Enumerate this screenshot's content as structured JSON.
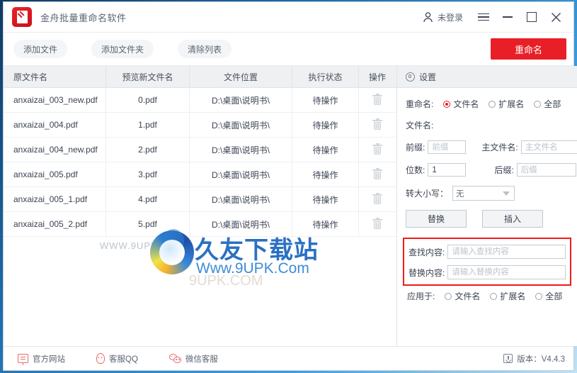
{
  "window": {
    "title": "金舟批量重命名软件",
    "app_icon": "pen-document-icon",
    "user_label": "未登录",
    "user_icon": "person-icon",
    "menu_icon": "hamburger-icon",
    "minimize_icon": "minimize-icon",
    "maximize_icon": "maximize-icon",
    "close_icon": "close-icon"
  },
  "toolbar": {
    "add_file": "添加文件",
    "add_folder": "添加文件夹",
    "clear_list": "清除列表",
    "rename": "重命名",
    "rename_color": "#e81f26"
  },
  "table": {
    "headers": [
      "原文件名",
      "预览新文件名",
      "文件位置",
      "执行状态",
      "操作"
    ],
    "delete_icon": "trash-icon",
    "rows": [
      {
        "original": "anxaizai_003_new.pdf",
        "preview": "0.pdf",
        "location": "D:\\桌面\\说明书\\",
        "status": "待操作"
      },
      {
        "original": "anxaizai_004.pdf",
        "preview": "1.pdf",
        "location": "D:\\桌面\\说明书\\",
        "status": "待操作"
      },
      {
        "original": "anxaizai_004_new.pdf",
        "preview": "2.pdf",
        "location": "D:\\桌面\\说明书\\",
        "status": "待操作"
      },
      {
        "original": "anxaizai_005.pdf",
        "preview": "3.pdf",
        "location": "D:\\桌面\\说明书\\",
        "status": "待操作"
      },
      {
        "original": "anxaizai_005_1.pdf",
        "preview": "4.pdf",
        "location": "D:\\桌面\\说明书\\",
        "status": "待操作"
      },
      {
        "original": "anxaizai_005_2.pdf",
        "preview": "5.pdf",
        "location": "D:\\桌面\\说明书\\",
        "status": "待操作"
      }
    ]
  },
  "watermark": {
    "brand": "久友下载站",
    "url": "Www.9UPK.Com",
    "small": "WWW.9UPK.COM",
    "ghost": "9UPK.COM"
  },
  "settings": {
    "panel_title": "设置",
    "panel_icon": "gear-icon",
    "rename_label": "重命名:",
    "rename_options": [
      {
        "label": "文件名",
        "selected": true
      },
      {
        "label": "扩展名",
        "selected": false
      },
      {
        "label": "全部",
        "selected": false
      }
    ],
    "filename_label": "文件名:",
    "prefix_label": "前缀:",
    "prefix_placeholder": "前缀",
    "prefix_value": "",
    "mainname_label": "主文件名:",
    "mainname_placeholder": "主文件名",
    "mainname_value": "",
    "digits_label": "位数:",
    "digits_value": "1",
    "suffix_label": "后缀:",
    "suffix_placeholder": "后缀",
    "suffix_value": "",
    "case_label": "转大小写：",
    "case_value": "无",
    "case_caret": "chevron-down-icon",
    "replace_button": "替换",
    "insert_button": "插入",
    "highlight_color": "#f01a1a",
    "find_label": "查找内容:",
    "find_placeholder": "请输入查找内容",
    "find_value": "",
    "replace_label": "替换内容:",
    "replace_placeholder": "请输入替换内容",
    "replace_value": "",
    "apply_label": "应用于:",
    "apply_options": [
      {
        "label": "文件名",
        "selected": false
      },
      {
        "label": "扩展名",
        "selected": false
      },
      {
        "label": "全部",
        "selected": false
      }
    ]
  },
  "status": {
    "website": "官方网站",
    "website_icon": "monitor-icon",
    "qq": "客服QQ",
    "qq_icon": "penguin-icon",
    "wechat": "微信客服",
    "wechat_icon": "wechat-icon",
    "version": "版本：V4.4.3",
    "version_icon": "download-icon"
  }
}
